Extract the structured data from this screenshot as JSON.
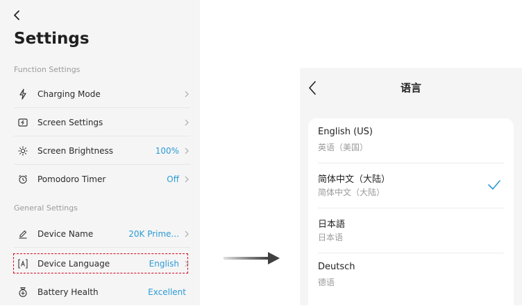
{
  "settings": {
    "title": "Settings",
    "function_header": "Function Settings",
    "general_header": "General Settings",
    "items": {
      "charging_mode": {
        "label": "Charging Mode",
        "value": ""
      },
      "screen_settings": {
        "label": "Screen Settings",
        "value": ""
      },
      "screen_brightness": {
        "label": "Screen Brightness",
        "value": "100%"
      },
      "pomodoro_timer": {
        "label": "Pomodoro Timer",
        "value": "Off"
      },
      "device_name": {
        "label": "Device Name",
        "value": "20K Prime..."
      },
      "device_language": {
        "label": "Device Language",
        "value": "English"
      },
      "battery_health": {
        "label": "Battery Health",
        "value": "Excellent"
      }
    }
  },
  "language": {
    "title": "语言",
    "options": [
      {
        "name": "English (US)",
        "sub": "英语（美国）",
        "selected": false
      },
      {
        "name": "简体中文（大陆）",
        "sub": "简体中文（大陆）",
        "selected": true
      },
      {
        "name": "日本語",
        "sub": "日本语",
        "selected": false
      },
      {
        "name": "Deutsch",
        "sub": "德语",
        "selected": false
      }
    ]
  },
  "colors": {
    "accent": "#2b9bd6",
    "highlight": "#d0021b",
    "panel_bg": "#f5f5f5"
  }
}
